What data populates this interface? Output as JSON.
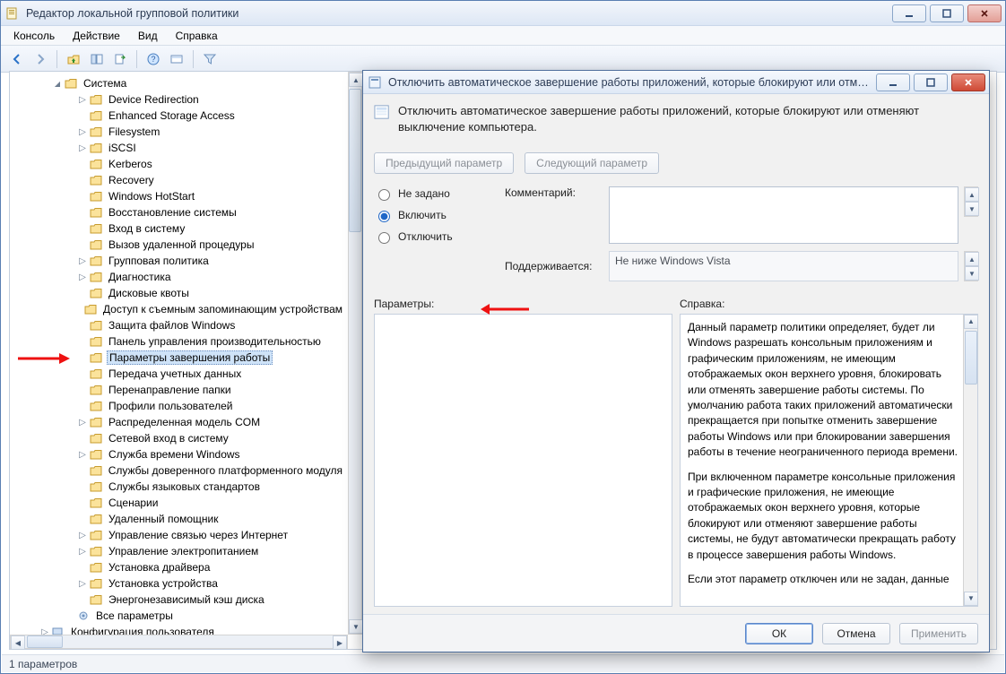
{
  "window": {
    "title": "Редактор локальной групповой политики"
  },
  "menu": {
    "items": [
      "Консоль",
      "Действие",
      "Вид",
      "Справка"
    ]
  },
  "tree": {
    "root_label": "Система",
    "items": [
      {
        "l": "Device Redirection",
        "exp": true
      },
      {
        "l": "Enhanced Storage Access",
        "exp": false
      },
      {
        "l": "Filesystem",
        "exp": true
      },
      {
        "l": "iSCSI",
        "exp": true
      },
      {
        "l": "Kerberos",
        "exp": false
      },
      {
        "l": "Recovery",
        "exp": false
      },
      {
        "l": "Windows HotStart",
        "exp": false
      },
      {
        "l": "Восстановление системы",
        "exp": false
      },
      {
        "l": "Вход в систему",
        "exp": false
      },
      {
        "l": "Вызов удаленной процедуры",
        "exp": false
      },
      {
        "l": "Групповая политика",
        "exp": true
      },
      {
        "l": "Диагностика",
        "exp": true
      },
      {
        "l": "Дисковые квоты",
        "exp": false
      },
      {
        "l": "Доступ к съемным запоминающим устройствам",
        "exp": false
      },
      {
        "l": "Защита файлов Windows",
        "exp": false
      },
      {
        "l": "Панель управления производительностью",
        "exp": false
      },
      {
        "l": "Параметры завершения работы",
        "exp": false,
        "sel": true
      },
      {
        "l": "Передача учетных данных",
        "exp": false
      },
      {
        "l": "Перенаправление папки",
        "exp": false
      },
      {
        "l": "Профили пользователей",
        "exp": false
      },
      {
        "l": "Распределенная модель COM",
        "exp": true
      },
      {
        "l": "Сетевой вход в систему",
        "exp": false
      },
      {
        "l": "Служба времени Windows",
        "exp": true
      },
      {
        "l": "Службы доверенного платформенного модуля",
        "exp": false
      },
      {
        "l": "Службы языковых стандартов",
        "exp": false
      },
      {
        "l": "Сценарии",
        "exp": false
      },
      {
        "l": "Удаленный помощник",
        "exp": false
      },
      {
        "l": "Управление связью через Интернет",
        "exp": true
      },
      {
        "l": "Управление электропитанием",
        "exp": true
      },
      {
        "l": "Установка драйвера",
        "exp": false
      },
      {
        "l": "Установка устройства",
        "exp": true
      },
      {
        "l": "Энергонезависимый кэш диска",
        "exp": false
      }
    ],
    "all_settings": "Все параметры",
    "user_config": "Конфигурация пользователя"
  },
  "dialog": {
    "title_short": "Отключить автоматическое завершение работы приложений, которые блокируют или отменяют в...",
    "setting_name": "Отключить автоматическое завершение работы приложений, которые блокируют или отменяют выключение компьютера.",
    "prev": "Предыдущий параметр",
    "next": "Следующий параметр",
    "state": {
      "not_configured": "Не задано",
      "enabled": "Включить",
      "disabled": "Отключить",
      "selected": "enabled"
    },
    "comment_label": "Комментарий:",
    "comment_value": "",
    "supported_label": "Поддерживается:",
    "supported_value": "Не ниже Windows Vista",
    "params_label": "Параметры:",
    "help_label": "Справка:",
    "help_p1": "Данный параметр политики определяет, будет ли Windows разрешать консольным приложениям и графическим приложениям, не имеющим отображаемых окон верхнего уровня, блокировать или отменять завершение работы системы. По умолчанию работа таких приложений автоматически прекращается при попытке отменить завершение работы Windows или при блокировании завершения работы в течение неограниченного периода времени.",
    "help_p2": "При включенном параметре консольные приложения и графические приложения, не имеющие отображаемых окон верхнего уровня, которые блокируют или отменяют завершение работы системы, не будут автоматически прекращать работу в процессе завершения работы Windows.",
    "help_p3": "Если этот параметр отключен или не задан, данные",
    "ok": "ОК",
    "cancel": "Отмена",
    "apply": "Применить"
  },
  "status": {
    "text": "1 параметров"
  }
}
